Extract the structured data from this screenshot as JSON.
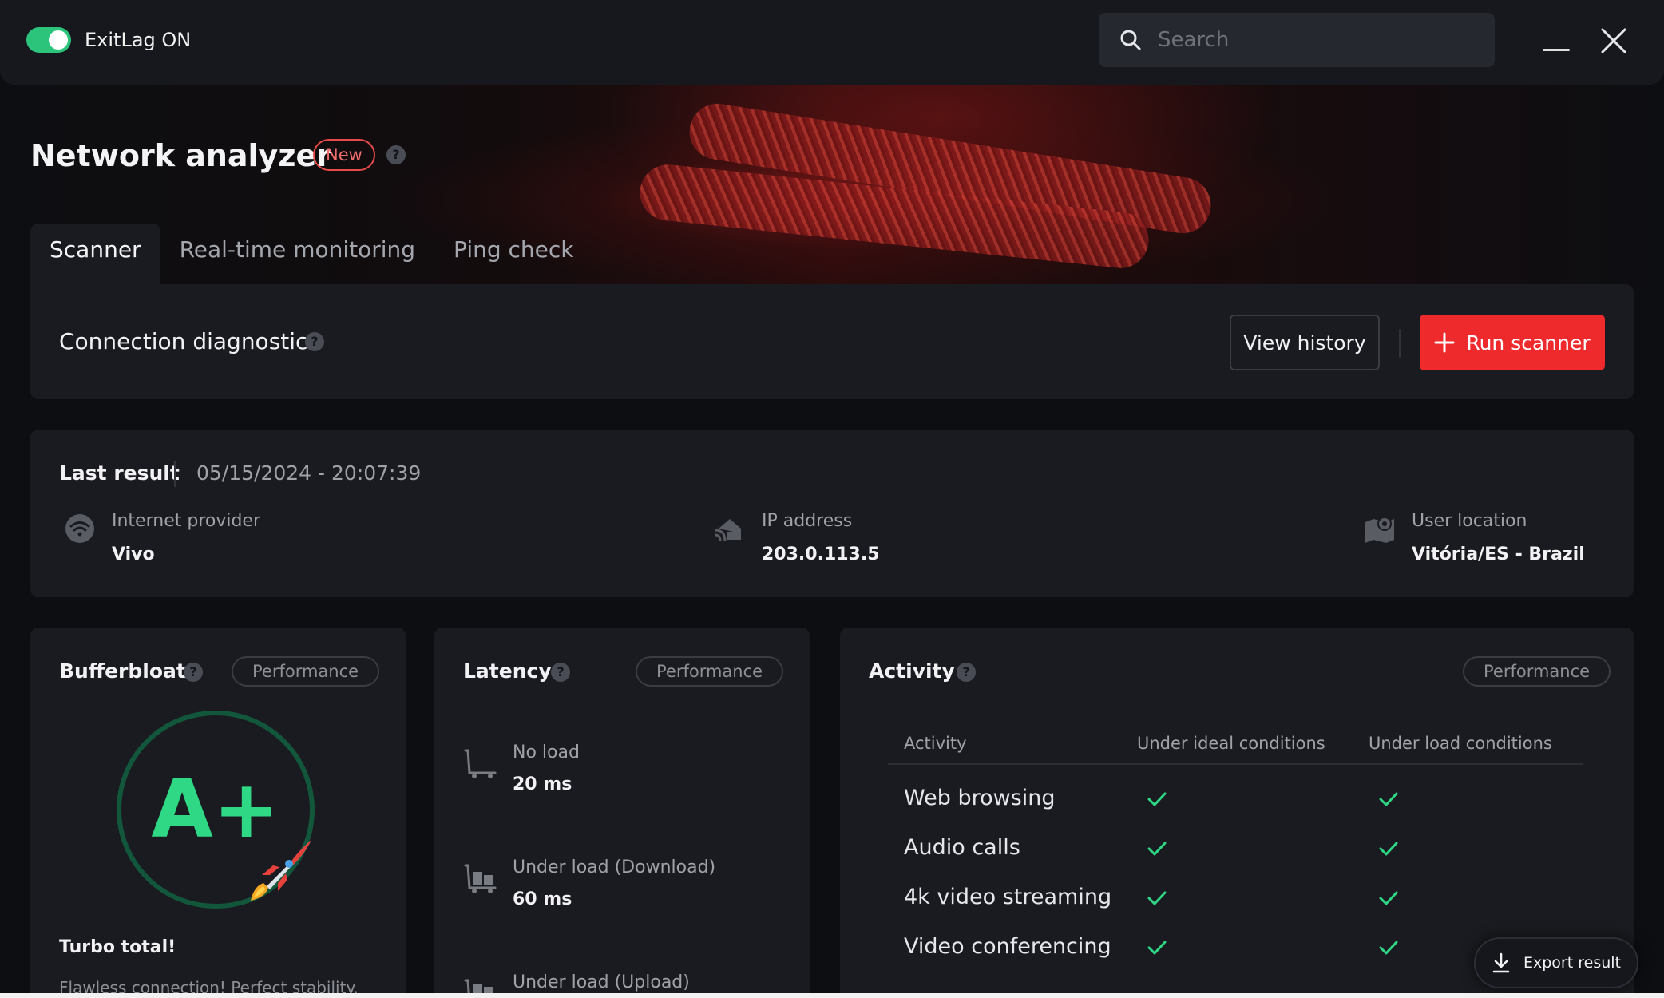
{
  "app": {
    "status_label": "ExitLag ON",
    "toggle_on": true
  },
  "search": {
    "placeholder": "Search"
  },
  "page": {
    "title": "Network analyzer",
    "badge": "New"
  },
  "tabs": [
    {
      "label": "Scanner",
      "active": true
    },
    {
      "label": "Real-time monitoring",
      "active": false
    },
    {
      "label": "Ping check",
      "active": false
    }
  ],
  "diagnostic": {
    "title": "Connection diagnostic",
    "view_history_label": "View history",
    "run_scanner_label": "Run scanner"
  },
  "last_result": {
    "label": "Last result",
    "date": "05/15/2024 - 20:07:39",
    "provider_label": "Internet provider",
    "provider_value": "Vivo",
    "ip_label": "IP address",
    "ip_value": "203.0.113.5",
    "location_label": "User location",
    "location_value": "Vitória/ES - Brazil"
  },
  "bufferbloat": {
    "title": "Bufferbloat",
    "pill": "Performance",
    "grade": "A+",
    "headline": "Turbo total!",
    "description": "Flawless connection! Perfect stability."
  },
  "latency": {
    "title": "Latency",
    "pill": "Performance",
    "items": [
      {
        "label": "No load",
        "value": "20 ms"
      },
      {
        "label": "Under load (Download)",
        "value": "60 ms"
      },
      {
        "label": "Under load (Upload)",
        "value": ""
      }
    ]
  },
  "activity": {
    "title": "Activity",
    "pill": "Performance",
    "columns": [
      "Activity",
      "Under ideal conditions",
      "Under load conditions"
    ],
    "rows": [
      {
        "name": "Web browsing",
        "ideal": true,
        "load": true
      },
      {
        "name": "Audio calls",
        "ideal": true,
        "load": true
      },
      {
        "name": "4k video streaming",
        "ideal": true,
        "load": true
      },
      {
        "name": "Video conferencing",
        "ideal": true,
        "load": true
      }
    ]
  },
  "export": {
    "label": "Export result"
  },
  "colors": {
    "accent_green": "#2cc37b",
    "accent_red": "#ee2a2d",
    "grade_green": "#2fd885"
  }
}
